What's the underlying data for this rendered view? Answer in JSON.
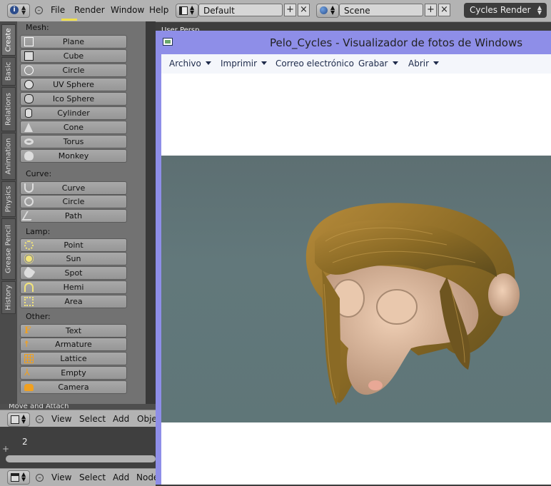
{
  "blender": {
    "menu": [
      "File",
      "Render",
      "Window",
      "Help"
    ],
    "layout_field": "Default",
    "scene_field": "Scene",
    "render_engine": "Cycles Render",
    "viewport_label": "User Persp"
  },
  "tool_tabs": [
    "Create",
    "Basic",
    "Relations",
    "Animation",
    "Physics",
    "Grease Pencil",
    "History"
  ],
  "tool_shelf": {
    "mesh_label": "Mesh:",
    "mesh": [
      "Plane",
      "Cube",
      "Circle",
      "UV Sphere",
      "Ico Sphere",
      "Cylinder",
      "Cone",
      "Torus",
      "Monkey"
    ],
    "curve_label": "Curve:",
    "curve": [
      "Curve",
      "Circle",
      "Path"
    ],
    "lamp_label": "Lamp:",
    "lamp": [
      "Point",
      "Sun",
      "Spot",
      "Hemi",
      "Area"
    ],
    "other_label": "Other:",
    "other": [
      "Text",
      "Armature",
      "Lattice",
      "Empty",
      "Camera"
    ],
    "move_panel": "Move and Attach"
  },
  "view3d_header": {
    "items": [
      "View",
      "Select",
      "Add",
      "Object"
    ]
  },
  "timeline": {
    "frame": "2"
  },
  "node_header": {
    "items": [
      "View",
      "Select",
      "Add",
      "Node"
    ]
  },
  "viewer": {
    "title": "Pelo_Cycles - Visualizador de fotos de Windows",
    "menu": [
      "Archivo",
      "Imprimir",
      "Correo electrónico",
      "Grabar",
      "Abrir"
    ]
  },
  "colors": {
    "blender_header": "#b3b3b3",
    "tool_shelf": "#727272",
    "viewer_frame": "#8e8ee8",
    "photo_background": "#5f7678",
    "hair": "#8a6a25",
    "skin": "#e7c3a6"
  }
}
